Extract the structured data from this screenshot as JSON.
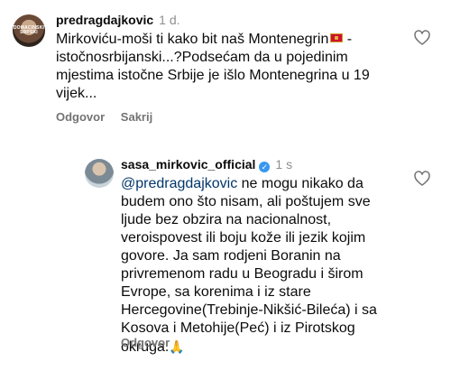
{
  "comments": [
    {
      "avatar_text": "DOMACINSKI SRPSKI",
      "username": "predragdajkovic",
      "time": "1 d.",
      "body_before_flag": "Mirkoviću-moši ti kako bit naš Montenegrin",
      "flag_icon": "montenegro-flag",
      "body_after_flag": " -istočnosrbijanski...?Podsećam da u pojedinim mjestima istočne Srbije je išlo Montenegrina u 19 vijek...",
      "reply_label": "Odgovor",
      "hide_label": "Sakrij"
    },
    {
      "username": "sasa_mirkovic_official",
      "verified_icon": "verified-check",
      "time": "1 s",
      "mention": "@predragdajkovic",
      "body": " ne mogu nikako da budem ono što nisam, ali poštujem sve ljude bez obzira na nacionalnost, veroispovest ili boju kože ili jezik kojim govore. Ja sam rodjeni Boranin na privremenom radu u Beogradu i širom Evrope, sa korenima i iz stare Hercegovine(Trebinje-Nikšić-Bileća) i sa Kosova i Metohije(Peć) i iz Pirotskog okruga.",
      "emoji": "🙏",
      "reply_label": "Odgovor"
    }
  ],
  "colors": {
    "text": "#0b0b0b",
    "muted": "#8e8e8e",
    "mention": "#00376b",
    "verified": "#3897f0"
  }
}
